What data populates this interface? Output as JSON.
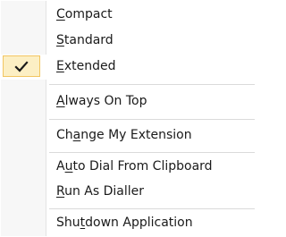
{
  "menu": {
    "items": [
      {
        "id": "compact",
        "label": "Compact",
        "mnemonic": "C"
      },
      {
        "id": "standard",
        "label": "Standard",
        "mnemonic": "S"
      },
      {
        "id": "extended",
        "label": "Extended",
        "mnemonic": "E",
        "checked": true
      },
      {
        "id": "always_on_top",
        "label": "Always On Top",
        "mnemonic": "A"
      },
      {
        "id": "change_extension",
        "label": "Change My Extension",
        "mnemonic": "a"
      },
      {
        "id": "auto_dial",
        "label": "Auto Dial From Clipboard",
        "mnemonic": "u"
      },
      {
        "id": "run_as_dialler",
        "label": "Run As Dialler",
        "mnemonic": "R"
      },
      {
        "id": "shutdown",
        "label": "Shutdown Application",
        "mnemonic": "d"
      }
    ],
    "check_icon": "checkmark-icon"
  },
  "colors": {
    "gutter": "#f7f7f7",
    "check_background": "#fcefc4",
    "check_border": "#f2c561",
    "separator": "#dadada",
    "text": "#1a1a1a"
  }
}
